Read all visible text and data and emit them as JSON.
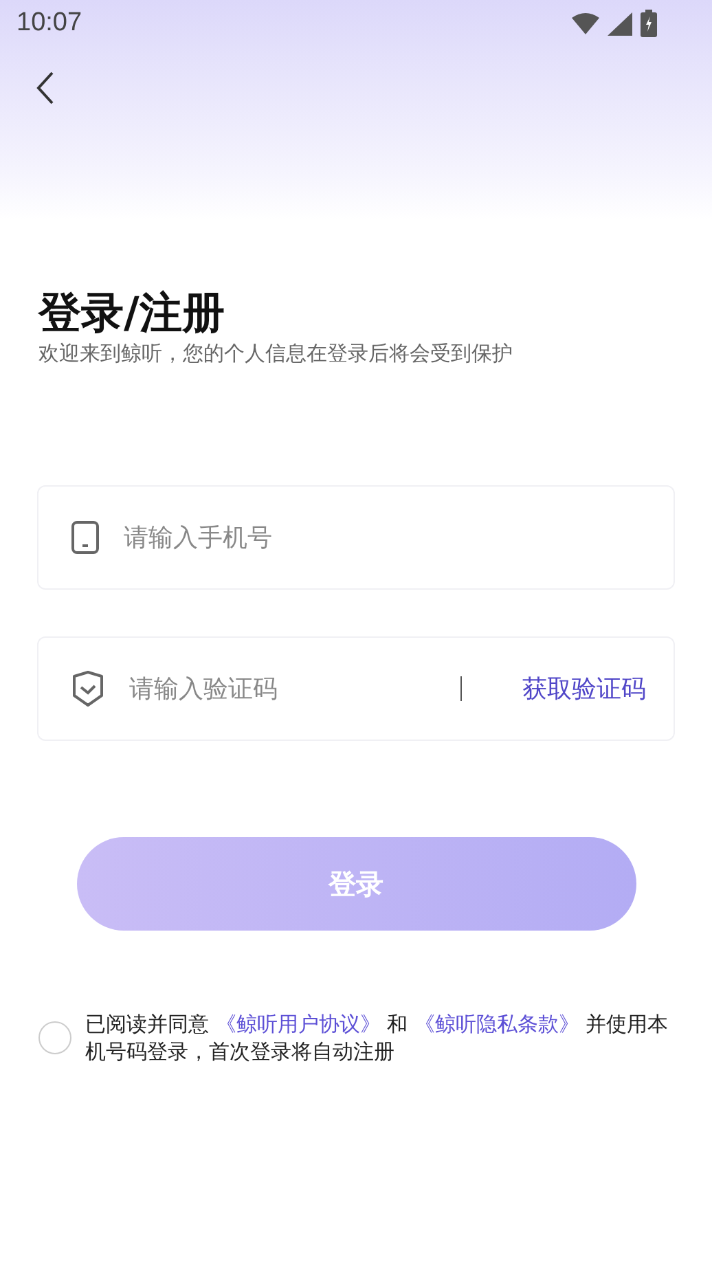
{
  "status_bar": {
    "time": "10:07"
  },
  "header": {
    "title": "登录/注册",
    "subtitle": "欢迎来到鲸听，您的个人信息在登录后将会受到保护"
  },
  "fields": [
    {
      "kind": "phone",
      "placeholder": "请输入手机号"
    },
    {
      "kind": "code",
      "placeholder": "请输入验证码",
      "action": "获取验证码"
    }
  ],
  "login_button": {
    "label": "登录",
    "disabled": true
  },
  "agreement": {
    "checked": false,
    "parts": [
      {
        "kind": "text",
        "text": "已阅读并同意 "
      },
      {
        "kind": "link",
        "text": "《鲸听用户协议》"
      },
      {
        "kind": "text",
        "text": " 和 "
      },
      {
        "kind": "link",
        "text": "《鲸听隐私条款》"
      },
      {
        "kind": "text",
        "text": " 并使用本机号码登录，首次登录将自动注册"
      }
    ]
  }
}
